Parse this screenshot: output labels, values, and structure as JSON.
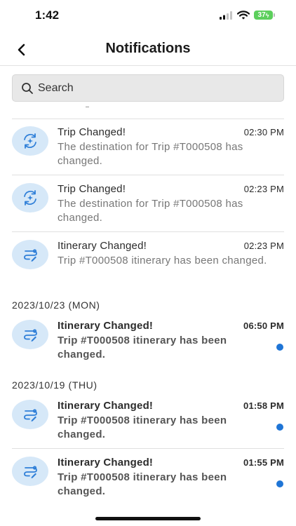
{
  "status_bar": {
    "time": "1:42",
    "battery": "37"
  },
  "header": {
    "title": "Notifications"
  },
  "search": {
    "placeholder": "Search"
  },
  "notifications_top": [
    {
      "title": "Trip Changed!",
      "time": "02:30 PM",
      "message": "The destination for Trip #T000508 has changed.",
      "icon": "sync-sparkle-icon"
    },
    {
      "title": "Trip Changed!",
      "time": "02:23 PM",
      "message": "The destination for Trip #T000508 has changed.",
      "icon": "sync-sparkle-icon"
    },
    {
      "title": "Itinerary Changed!",
      "time": "02:23 PM",
      "message": "Trip #T000508 itinerary has been changed.",
      "icon": "route-edit-icon"
    }
  ],
  "groups": [
    {
      "date": "2023/10/23 (MON)",
      "items": [
        {
          "title": "Itinerary Changed!",
          "time": "06:50 PM",
          "message": "Trip #T000508 itinerary has been changed.",
          "icon": "route-edit-icon",
          "unread": true
        }
      ]
    },
    {
      "date": "2023/10/19 (THU)",
      "items": [
        {
          "title": "Itinerary Changed!",
          "time": "01:58 PM",
          "message": "Trip #T000508 itinerary has been changed.",
          "icon": "route-edit-icon",
          "unread": true
        },
        {
          "title": "Itinerary Changed!",
          "time": "01:55 PM",
          "message": "Trip #T000508 itinerary has been changed.",
          "icon": "route-edit-icon",
          "unread": true
        }
      ]
    }
  ],
  "colors": {
    "icon_circle": "#d6e8f8",
    "icon_stroke": "#2f7fd8",
    "unread_dot": "#1f75d6"
  }
}
